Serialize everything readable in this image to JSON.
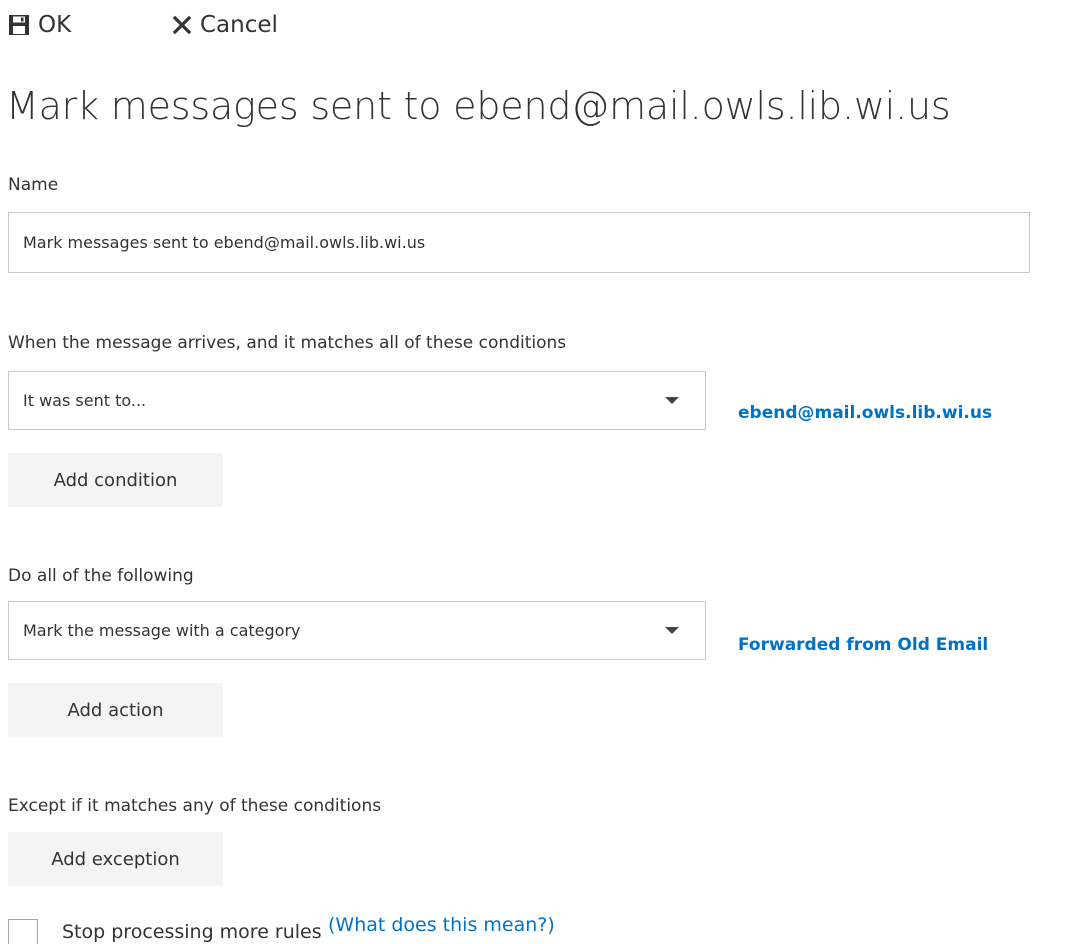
{
  "toolbar": {
    "ok_label": "OK",
    "cancel_label": "Cancel"
  },
  "page_title": "Mark messages sent to ebend@mail.owls.lib.wi.us",
  "name_section": {
    "label": "Name",
    "value": "Mark messages sent to ebend@mail.owls.lib.wi.us"
  },
  "conditions": {
    "heading": "When the message arrives, and it matches all of these conditions",
    "selected": "It was sent to...",
    "value_link": "ebend@mail.owls.lib.wi.us",
    "add_button": "Add condition"
  },
  "actions": {
    "heading": "Do all of the following",
    "selected": "Mark the message with a category",
    "value_link": "Forwarded from Old Email",
    "add_button": "Add action"
  },
  "exceptions": {
    "heading": "Except if it matches any of these conditions",
    "add_button": "Add exception"
  },
  "stop_processing": {
    "label": "Stop processing more rules",
    "help_link": "(What does this mean?)",
    "checked": false
  },
  "colors": {
    "accent": "#0072c6",
    "text": "#333333",
    "button_bg": "#f4f4f4",
    "border": "#c8c8c8"
  },
  "icons": {
    "ok": "save-icon",
    "cancel": "close-icon",
    "dropdown": "chevron-down-icon"
  }
}
